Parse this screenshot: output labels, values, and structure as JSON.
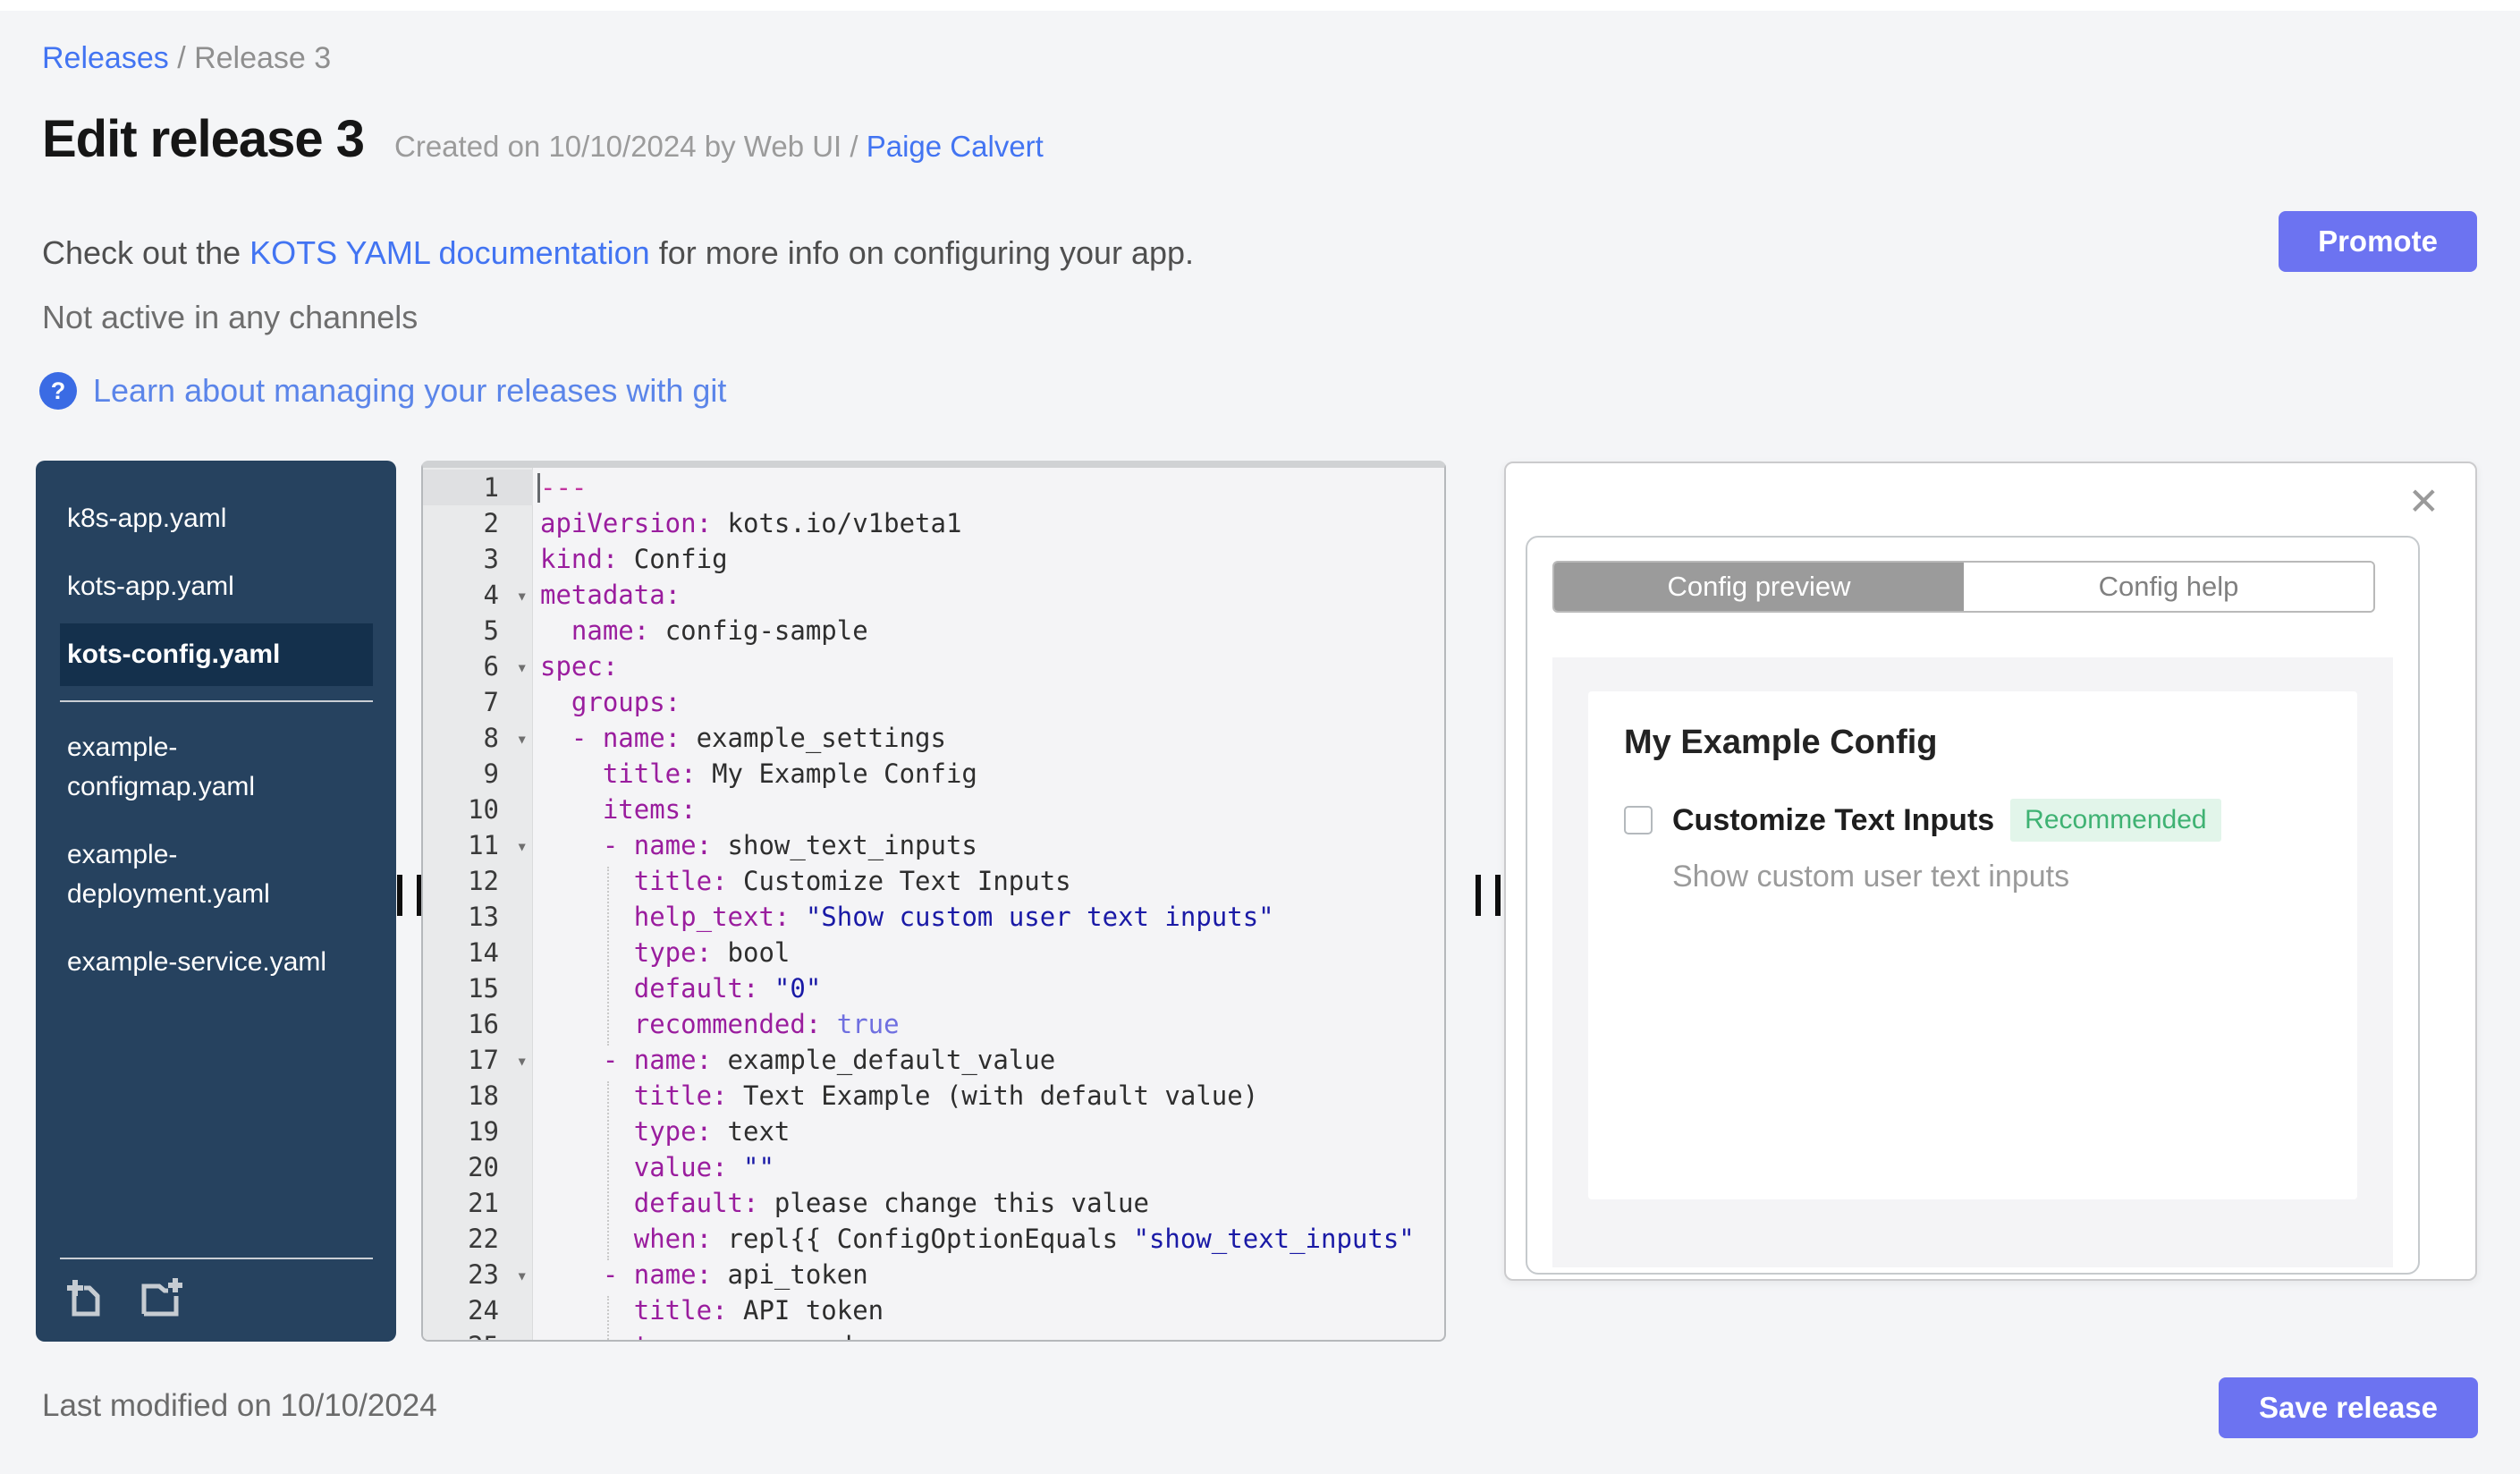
{
  "colors": {
    "accent": "#6c73f1",
    "link_blue": "#4274f2",
    "soft_link_blue": "#5b85e9",
    "sidebar_bg": "#26425f",
    "sidebar_selected_bg": "#14304c",
    "tab_active_bg": "#9b9b9b",
    "badge_green_text": "#3fb273",
    "badge_green_bg": "#e2f5ea",
    "code_key": "#9a1d9e",
    "code_string": "#1a1aa6",
    "code_boolean": "#6f6fe0",
    "code_doc_marker": "#c2359f"
  },
  "breadcrumb": {
    "link": "Releases",
    "separator": " / ",
    "current": "Release 3"
  },
  "header": {
    "title": "Edit release 3",
    "created_prefix": "Created on 10/10/2024 by Web UI / ",
    "created_link": "Paige Calvert",
    "promote_label": "Promote",
    "doc_prefix": "Check out the ",
    "doc_link": "KOTS YAML documentation",
    "doc_suffix": " for more info on configuring your app.",
    "channel_status": "Not active in any channels",
    "help_icon": "?",
    "git_link": "Learn about managing your releases with git"
  },
  "file_tree": {
    "divider_after": 2,
    "files": [
      {
        "name": "k8s-app.yaml",
        "selected": false
      },
      {
        "name": "kots-app.yaml",
        "selected": false
      },
      {
        "name": "kots-config.yaml",
        "selected": true
      },
      {
        "name": "example-configmap.yaml",
        "selected": false
      },
      {
        "name": "example-deployment.yaml",
        "selected": false
      },
      {
        "name": "example-service.yaml",
        "selected": false
      }
    ],
    "icons": [
      "add-file-icon",
      "add-folder-icon"
    ]
  },
  "editor": {
    "active_line": 1,
    "fold_icon": "▾",
    "fold_lines": [
      4,
      6,
      8,
      11,
      17,
      23
    ],
    "lines": [
      [
        [
          "doc",
          "---"
        ]
      ],
      [
        [
          "key",
          "apiVersion:"
        ],
        [
          "plain",
          " kots.io/v1beta1"
        ]
      ],
      [
        [
          "key",
          "kind:"
        ],
        [
          "plain",
          " Config"
        ]
      ],
      [
        [
          "key",
          "metadata:"
        ]
      ],
      [
        [
          "plain",
          "  "
        ],
        [
          "key",
          "name:"
        ],
        [
          "plain",
          " config-sample"
        ]
      ],
      [
        [
          "key",
          "spec:"
        ]
      ],
      [
        [
          "plain",
          "  "
        ],
        [
          "key",
          "groups:"
        ]
      ],
      [
        [
          "plain",
          "  "
        ],
        [
          "key",
          "- name:"
        ],
        [
          "plain",
          " example_settings"
        ]
      ],
      [
        [
          "plain",
          "    "
        ],
        [
          "key",
          "title:"
        ],
        [
          "plain",
          " My Example Config"
        ]
      ],
      [
        [
          "plain",
          "    "
        ],
        [
          "key",
          "items:"
        ]
      ],
      [
        [
          "plain",
          "    "
        ],
        [
          "key",
          "- name:"
        ],
        [
          "plain",
          " show_text_inputs"
        ]
      ],
      [
        [
          "plain",
          "      "
        ],
        [
          "key",
          "title:"
        ],
        [
          "plain",
          " Customize Text Inputs"
        ]
      ],
      [
        [
          "plain",
          "      "
        ],
        [
          "key",
          "help_text:"
        ],
        [
          "plain",
          " "
        ],
        [
          "str",
          "\"Show custom user text inputs\""
        ]
      ],
      [
        [
          "plain",
          "      "
        ],
        [
          "key",
          "type:"
        ],
        [
          "plain",
          " bool"
        ]
      ],
      [
        [
          "plain",
          "      "
        ],
        [
          "key",
          "default:"
        ],
        [
          "plain",
          " "
        ],
        [
          "str",
          "\"0\""
        ]
      ],
      [
        [
          "plain",
          "      "
        ],
        [
          "key",
          "recommended:"
        ],
        [
          "plain",
          " "
        ],
        [
          "bool",
          "true"
        ]
      ],
      [
        [
          "plain",
          "    "
        ],
        [
          "key",
          "- name:"
        ],
        [
          "plain",
          " example_default_value"
        ]
      ],
      [
        [
          "plain",
          "      "
        ],
        [
          "key",
          "title:"
        ],
        [
          "plain",
          " Text Example (with default value)"
        ]
      ],
      [
        [
          "plain",
          "      "
        ],
        [
          "key",
          "type:"
        ],
        [
          "plain",
          " text"
        ]
      ],
      [
        [
          "plain",
          "      "
        ],
        [
          "key",
          "value:"
        ],
        [
          "plain",
          " "
        ],
        [
          "str",
          "\"\""
        ]
      ],
      [
        [
          "plain",
          "      "
        ],
        [
          "key",
          "default:"
        ],
        [
          "plain",
          " please change this value"
        ]
      ],
      [
        [
          "plain",
          "      "
        ],
        [
          "key",
          "when:"
        ],
        [
          "plain",
          " repl{{ ConfigOptionEquals "
        ],
        [
          "str",
          "\"show_text_inputs\""
        ]
      ],
      [
        [
          "plain",
          "    "
        ],
        [
          "key",
          "- name:"
        ],
        [
          "plain",
          " api_token"
        ]
      ],
      [
        [
          "plain",
          "      "
        ],
        [
          "key",
          "title:"
        ],
        [
          "plain",
          " API token"
        ]
      ],
      [
        [
          "plain",
          "      "
        ],
        [
          "key",
          "type:"
        ],
        [
          "plain",
          " password"
        ]
      ]
    ]
  },
  "config_panel": {
    "close_icon": "✕",
    "tabs": [
      {
        "label": "Config preview",
        "active": true
      },
      {
        "label": "Config help",
        "active": false
      }
    ],
    "preview": {
      "group_title": "My Example Config",
      "item_label": "Customize Text Inputs",
      "badge": "Recommended",
      "help_text": "Show custom user text inputs",
      "checkbox_checked": false
    }
  },
  "footer": {
    "last_modified": "Last modified on 10/10/2024",
    "save_label": "Save release"
  }
}
